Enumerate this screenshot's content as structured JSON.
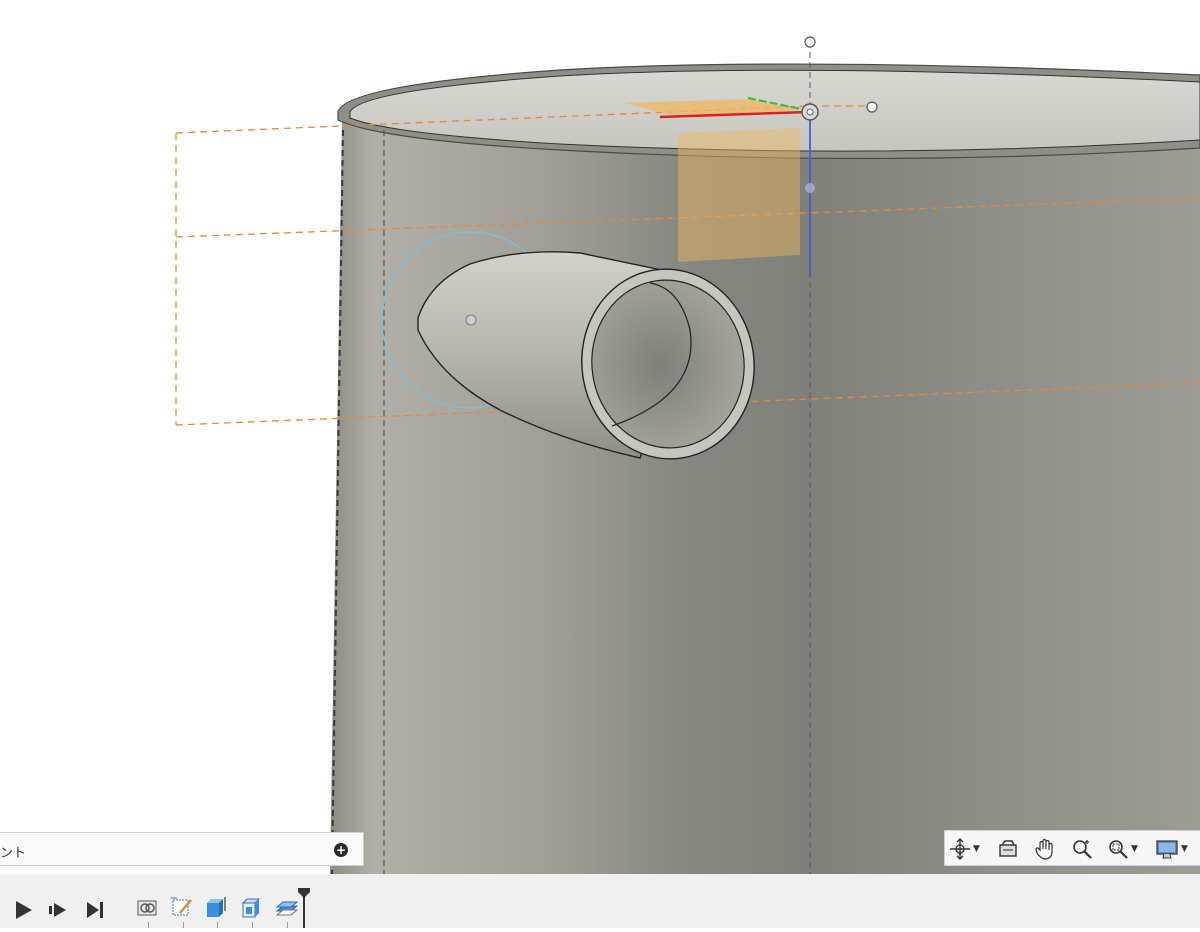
{
  "comments": {
    "label": "ント"
  },
  "nav_toolbar": {
    "items": [
      {
        "name": "orbit-icon",
        "dropdown": true
      },
      {
        "name": "look-at-icon",
        "dropdown": false
      },
      {
        "name": "pan-hand-icon",
        "dropdown": false
      },
      {
        "name": "zoom-icon",
        "dropdown": false
      },
      {
        "name": "zoom-window-icon",
        "dropdown": true
      },
      {
        "name": "display-settings-icon",
        "dropdown": true
      }
    ]
  },
  "timeline": {
    "controls": [
      "play-icon",
      "step-forward-icon",
      "go-to-end-icon"
    ],
    "features": [
      "joint-feature-icon",
      "sketch-feature-icon",
      "extrude-feature-icon",
      "shell-feature-icon",
      "offset-plane-feature-icon"
    ]
  },
  "colors": {
    "cylinder_light": "#b9b8b0",
    "cylinder_dark": "#7e7e76",
    "sketch_orange": "#e08a3c",
    "axis_blue": "#4b5bd6",
    "axis_red": "#e02020",
    "axis_green": "#2fbf2f",
    "plane_amber": "#f0b860",
    "timeline_bg": "#f0f0f0"
  }
}
